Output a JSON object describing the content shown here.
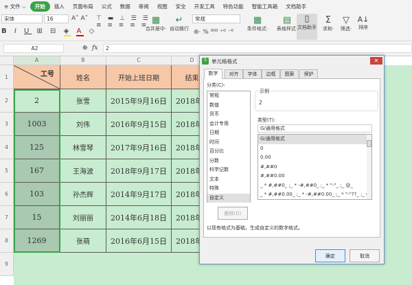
{
  "menu": {
    "items": [
      "≡ 文件 ⌵",
      "开始",
      "插入",
      "页面布局",
      "公式",
      "数据",
      "审阅",
      "视图",
      "安全",
      "开发工具",
      "特色功能",
      "智能工具箱",
      "文档助手"
    ],
    "active": "开始"
  },
  "ribbon": {
    "font": "宋体",
    "size": "16",
    "number_format": "常规",
    "merge": "合并居中·",
    "wrap": "自动换行",
    "cond": "条件格式·",
    "table_style": "表格样式·",
    "doc_helper": "文档助手",
    "sum": "求和·",
    "filter": "筛选·",
    "sort": "排序"
  },
  "formula": {
    "cell_ref": "A2",
    "fx": "fx",
    "value": "2"
  },
  "sheet": {
    "columns": [
      "A",
      "B",
      "C",
      "D"
    ],
    "rows": [
      "1",
      "2",
      "3",
      "4",
      "5",
      "6",
      "7",
      "8",
      "9"
    ],
    "header": [
      "工号",
      "姓名",
      "开始上班日期",
      "结束"
    ],
    "data": [
      [
        "2",
        "张雪",
        "2015年9月16日",
        "2018年"
      ],
      [
        "1003",
        "刘伟",
        "2016年9月15日",
        "2018年"
      ],
      [
        "125",
        "林雪琴",
        "2017年9月16日",
        "2018年"
      ],
      [
        "167",
        "王海波",
        "2018年9月17日",
        "2018年"
      ],
      [
        "103",
        "孙杰辉",
        "2014年9月17日",
        "2018年"
      ],
      [
        "15",
        "刘丽丽",
        "2014年6月18日",
        "2018年"
      ],
      [
        "1269",
        "张萌",
        "2016年6月15日",
        "2018年"
      ]
    ]
  },
  "dialog": {
    "title": "单元格格式",
    "tabs": [
      "数字",
      "对齐",
      "字体",
      "边框",
      "图案",
      "保护"
    ],
    "category_label": "分类(C):",
    "categories": [
      "常规",
      "数值",
      "货币",
      "会计专用",
      "日期",
      "时间",
      "百分比",
      "分数",
      "科学记数",
      "文本",
      "特殊",
      "自定义"
    ],
    "selected_category": "自定义",
    "sample_label": "示例",
    "sample_value": "2",
    "type_label": "类型(T):",
    "type_value": "G/通用格式",
    "types": [
      "G/通用格式",
      "0",
      "0.00",
      "#,##0",
      "#,##0.00",
      "_ * #,##0_ ;_ * -#,##0_ ;_ * \"-\"_ ;_ @_",
      "_ * #,##0.00_ ;_ * -#,##0.00_ ;_ * \"-\"??_ ;_ @_"
    ],
    "delete_button": "删除(D)",
    "description": "以现有格式为基础，生成自定义的数字格式。",
    "ok": "确定",
    "cancel": "取消"
  },
  "colors": {
    "accent": "#3aa347",
    "header_fill": "#f7c8a8",
    "data_fill": "#c8ecd0",
    "arrow": "#e8101a"
  }
}
